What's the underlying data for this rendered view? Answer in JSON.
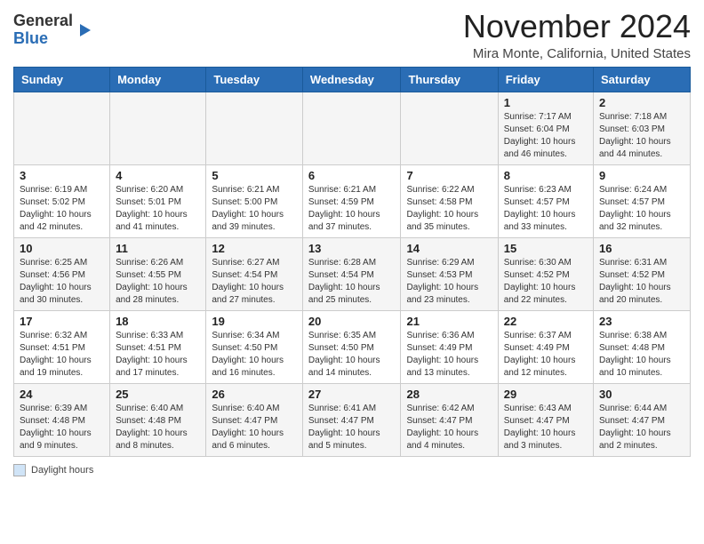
{
  "header": {
    "logo": {
      "general": "General",
      "blue": "Blue"
    },
    "title": "November 2024",
    "location": "Mira Monte, California, United States"
  },
  "calendar": {
    "days_of_week": [
      "Sunday",
      "Monday",
      "Tuesday",
      "Wednesday",
      "Thursday",
      "Friday",
      "Saturday"
    ],
    "weeks": [
      [
        {
          "day": "",
          "info": ""
        },
        {
          "day": "",
          "info": ""
        },
        {
          "day": "",
          "info": ""
        },
        {
          "day": "",
          "info": ""
        },
        {
          "day": "",
          "info": ""
        },
        {
          "day": "1",
          "info": "Sunrise: 7:17 AM\nSunset: 6:04 PM\nDaylight: 10 hours and 46 minutes."
        },
        {
          "day": "2",
          "info": "Sunrise: 7:18 AM\nSunset: 6:03 PM\nDaylight: 10 hours and 44 minutes."
        }
      ],
      [
        {
          "day": "3",
          "info": "Sunrise: 6:19 AM\nSunset: 5:02 PM\nDaylight: 10 hours and 42 minutes."
        },
        {
          "day": "4",
          "info": "Sunrise: 6:20 AM\nSunset: 5:01 PM\nDaylight: 10 hours and 41 minutes."
        },
        {
          "day": "5",
          "info": "Sunrise: 6:21 AM\nSunset: 5:00 PM\nDaylight: 10 hours and 39 minutes."
        },
        {
          "day": "6",
          "info": "Sunrise: 6:21 AM\nSunset: 4:59 PM\nDaylight: 10 hours and 37 minutes."
        },
        {
          "day": "7",
          "info": "Sunrise: 6:22 AM\nSunset: 4:58 PM\nDaylight: 10 hours and 35 minutes."
        },
        {
          "day": "8",
          "info": "Sunrise: 6:23 AM\nSunset: 4:57 PM\nDaylight: 10 hours and 33 minutes."
        },
        {
          "day": "9",
          "info": "Sunrise: 6:24 AM\nSunset: 4:57 PM\nDaylight: 10 hours and 32 minutes."
        }
      ],
      [
        {
          "day": "10",
          "info": "Sunrise: 6:25 AM\nSunset: 4:56 PM\nDaylight: 10 hours and 30 minutes."
        },
        {
          "day": "11",
          "info": "Sunrise: 6:26 AM\nSunset: 4:55 PM\nDaylight: 10 hours and 28 minutes."
        },
        {
          "day": "12",
          "info": "Sunrise: 6:27 AM\nSunset: 4:54 PM\nDaylight: 10 hours and 27 minutes."
        },
        {
          "day": "13",
          "info": "Sunrise: 6:28 AM\nSunset: 4:54 PM\nDaylight: 10 hours and 25 minutes."
        },
        {
          "day": "14",
          "info": "Sunrise: 6:29 AM\nSunset: 4:53 PM\nDaylight: 10 hours and 23 minutes."
        },
        {
          "day": "15",
          "info": "Sunrise: 6:30 AM\nSunset: 4:52 PM\nDaylight: 10 hours and 22 minutes."
        },
        {
          "day": "16",
          "info": "Sunrise: 6:31 AM\nSunset: 4:52 PM\nDaylight: 10 hours and 20 minutes."
        }
      ],
      [
        {
          "day": "17",
          "info": "Sunrise: 6:32 AM\nSunset: 4:51 PM\nDaylight: 10 hours and 19 minutes."
        },
        {
          "day": "18",
          "info": "Sunrise: 6:33 AM\nSunset: 4:51 PM\nDaylight: 10 hours and 17 minutes."
        },
        {
          "day": "19",
          "info": "Sunrise: 6:34 AM\nSunset: 4:50 PM\nDaylight: 10 hours and 16 minutes."
        },
        {
          "day": "20",
          "info": "Sunrise: 6:35 AM\nSunset: 4:50 PM\nDaylight: 10 hours and 14 minutes."
        },
        {
          "day": "21",
          "info": "Sunrise: 6:36 AM\nSunset: 4:49 PM\nDaylight: 10 hours and 13 minutes."
        },
        {
          "day": "22",
          "info": "Sunrise: 6:37 AM\nSunset: 4:49 PM\nDaylight: 10 hours and 12 minutes."
        },
        {
          "day": "23",
          "info": "Sunrise: 6:38 AM\nSunset: 4:48 PM\nDaylight: 10 hours and 10 minutes."
        }
      ],
      [
        {
          "day": "24",
          "info": "Sunrise: 6:39 AM\nSunset: 4:48 PM\nDaylight: 10 hours and 9 minutes."
        },
        {
          "day": "25",
          "info": "Sunrise: 6:40 AM\nSunset: 4:48 PM\nDaylight: 10 hours and 8 minutes."
        },
        {
          "day": "26",
          "info": "Sunrise: 6:40 AM\nSunset: 4:47 PM\nDaylight: 10 hours and 6 minutes."
        },
        {
          "day": "27",
          "info": "Sunrise: 6:41 AM\nSunset: 4:47 PM\nDaylight: 10 hours and 5 minutes."
        },
        {
          "day": "28",
          "info": "Sunrise: 6:42 AM\nSunset: 4:47 PM\nDaylight: 10 hours and 4 minutes."
        },
        {
          "day": "29",
          "info": "Sunrise: 6:43 AM\nSunset: 4:47 PM\nDaylight: 10 hours and 3 minutes."
        },
        {
          "day": "30",
          "info": "Sunrise: 6:44 AM\nSunset: 4:47 PM\nDaylight: 10 hours and 2 minutes."
        }
      ]
    ]
  },
  "legend": {
    "label": "Daylight hours"
  }
}
